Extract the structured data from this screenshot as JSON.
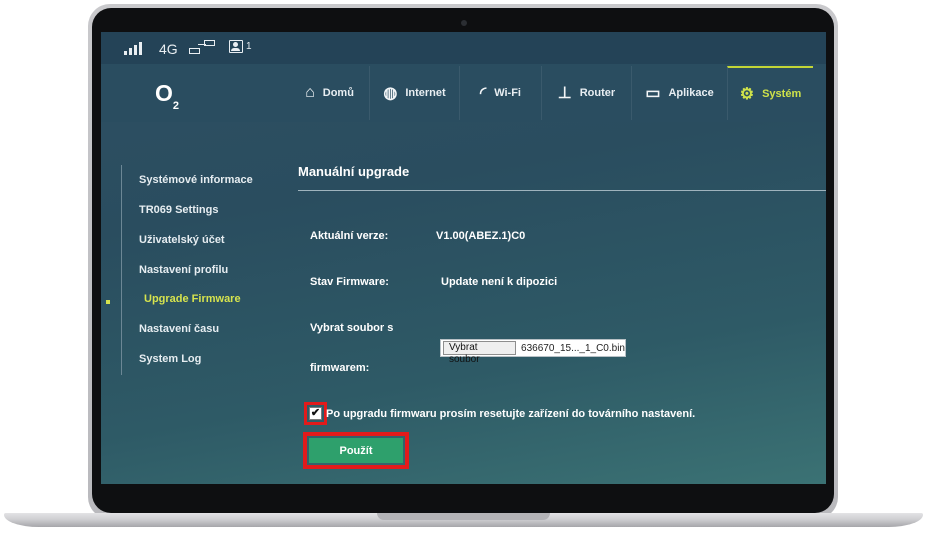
{
  "status": {
    "network_type": "4G",
    "user_count": "1"
  },
  "brand": {
    "logo_text": "O",
    "logo_sub": "2"
  },
  "nav": {
    "items": [
      {
        "label": "Domů",
        "icon": "home-icon"
      },
      {
        "label": "Internet",
        "icon": "globe-icon"
      },
      {
        "label": "Wi-Fi",
        "icon": "wifi-icon"
      },
      {
        "label": "Router",
        "icon": "router-icon"
      },
      {
        "label": "Aplikace",
        "icon": "monitor-icon"
      },
      {
        "label": "Systém",
        "icon": "gear-icon"
      }
    ],
    "active": "Systém"
  },
  "sidebar": {
    "items": [
      {
        "label": "Systémové informace"
      },
      {
        "label": "TR069 Settings"
      },
      {
        "label": "Uživatelský účet"
      },
      {
        "label": "Nastavení profilu"
      },
      {
        "label": "Upgrade Firmware"
      },
      {
        "label": "Nastavení času"
      },
      {
        "label": "System Log"
      }
    ],
    "active": "Upgrade Firmware"
  },
  "main": {
    "title": "Manuální upgrade",
    "current_version_label": "Aktuální verze:",
    "current_version_value": "V1.00(ABEZ.1)C0",
    "firmware_state_label": "Stav Firmware:",
    "firmware_state_value": "Update není k dipozici",
    "file_label_line1": "Vybrat soubor s",
    "file_label_line2": "firmwarem:",
    "file_button_label": "Vybrat soubor",
    "file_name": "636670_15..._1_C0.bin",
    "reset_checkbox_checked": true,
    "reset_checkbox_label": "Po upgradu firmwaru prosím resetujte zařízení do továrního nastavení.",
    "apply_button_label": "Použít"
  },
  "colors": {
    "accent": "#cfe24a",
    "button": "#2ea06c",
    "highlight": "#e21b1b"
  }
}
